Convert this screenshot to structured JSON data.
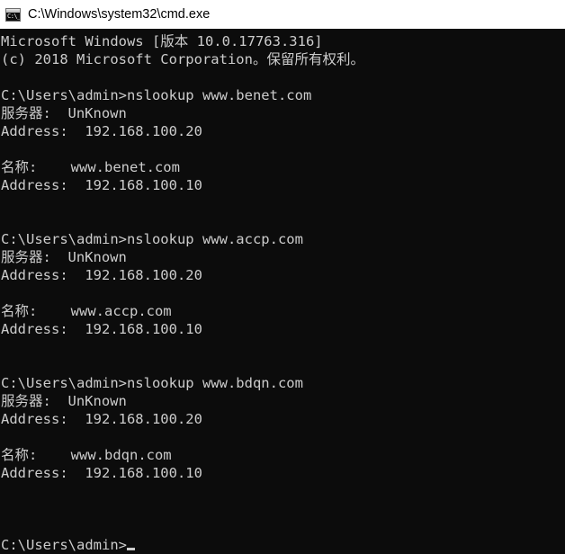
{
  "window": {
    "title": "C:\\Windows\\system32\\cmd.exe",
    "icon": "cmd-console-icon",
    "icon_text": "C:\\_",
    "titlebar_bg": "#ffffff",
    "titlebar_fg": "#000000",
    "console_bg": "#0c0c0c",
    "console_fg": "#cccccc"
  },
  "console": {
    "lines": [
      "Microsoft Windows [版本 10.0.17763.316]",
      "(c) 2018 Microsoft Corporation。保留所有权利。",
      "",
      "C:\\Users\\admin>nslookup www.benet.com",
      "服务器:  UnKnown",
      "Address:  192.168.100.20",
      "",
      "名称:    www.benet.com",
      "Address:  192.168.100.10",
      "",
      "",
      "C:\\Users\\admin>nslookup www.accp.com",
      "服务器:  UnKnown",
      "Address:  192.168.100.20",
      "",
      "名称:    www.accp.com",
      "Address:  192.168.100.10",
      "",
      "",
      "C:\\Users\\admin>nslookup www.bdqn.com",
      "服务器:  UnKnown",
      "Address:  192.168.100.20",
      "",
      "名称:    www.bdqn.com",
      "Address:  192.168.100.10",
      "",
      "",
      ""
    ],
    "prompt": "C:\\Users\\admin>",
    "cursor": "_"
  }
}
